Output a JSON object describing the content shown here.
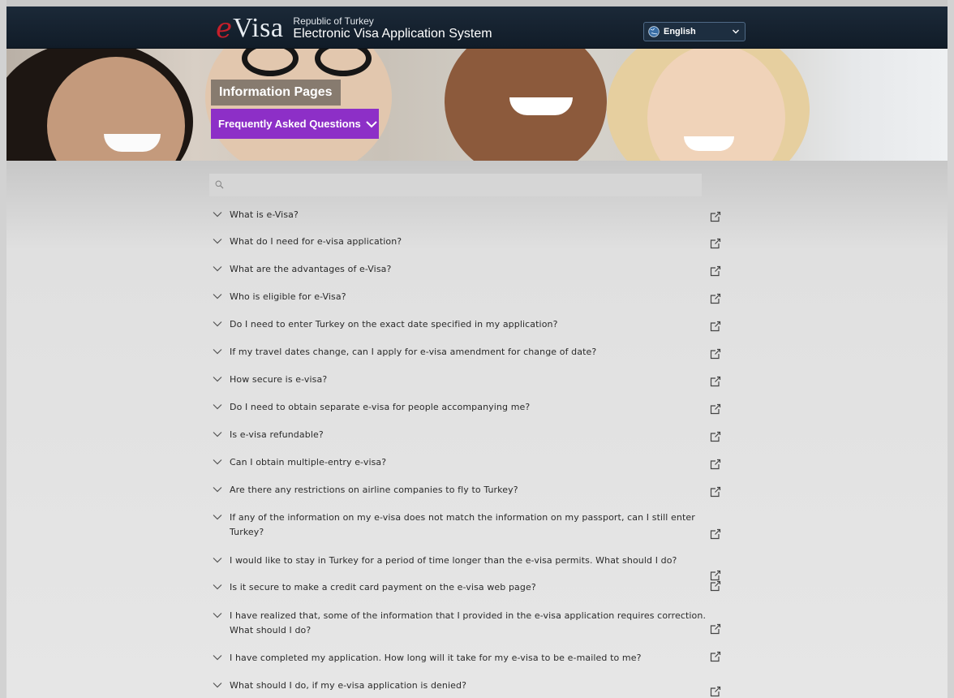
{
  "header": {
    "logo_e": "e",
    "logo_visa": "Visa",
    "subtitle": "Republic of Turkey",
    "title": "Electronic Visa Application System",
    "language": "English"
  },
  "banner": {
    "section": "Information Pages",
    "selector": "Frequently Asked Questions"
  },
  "search": {
    "placeholder": ""
  },
  "faq": [
    "What is e-Visa?",
    "What do I need for e-visa application?",
    "What are the advantages of e-Visa?",
    "Who is eligible for e-Visa?",
    "Do I need to enter Turkey on the exact date specified in my application?",
    "If my travel dates change, can I apply for e-visa amendment for change of date?",
    "How secure is e-visa?",
    "Do I need to obtain separate e-visa for people accompanying me?",
    "Is e-visa refundable?",
    "Can I obtain multiple-entry e-visa?",
    "Are there any restrictions on airline companies to fly to Turkey?",
    "If any of the information on my e-visa does not match the information on my passport, can I still enter Turkey?",
    "I would like to stay in Turkey for a period of time longer than the e-visa permits. What should I do?",
    "Is it secure to make a credit card payment on the e-visa web page?",
    "I have realized that, some of the information that I provided in the e-visa application requires correction. What should I do?",
    "I have completed my application. How long will it take for my e-visa to be e-mailed to me?",
    "What should I do, if my e-visa application is denied?"
  ],
  "colors": {
    "header_bg": "#141f2c",
    "accent_purple": "#8d2fc7",
    "logo_red": "#c71f2a",
    "content_bg": "#e5e5e5"
  }
}
